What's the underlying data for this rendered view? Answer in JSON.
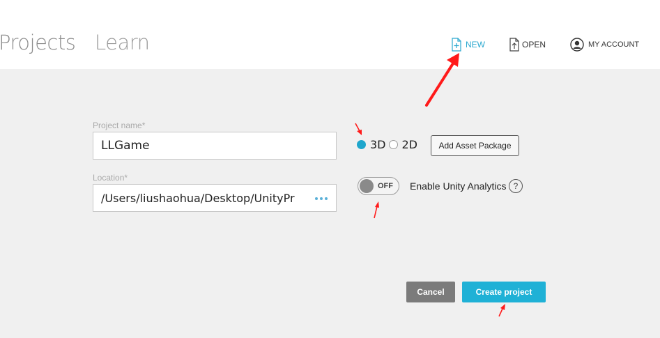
{
  "nav": {
    "tabs": [
      {
        "label": "Projects"
      },
      {
        "label": "Learn"
      }
    ]
  },
  "top_actions": {
    "new_label": "NEW",
    "open_label": "OPEN",
    "account_label": "MY ACCOUNT"
  },
  "form": {
    "project_name_label": "Project name*",
    "project_name_value": "LLGame",
    "location_label": "Location*",
    "location_value": "/Users/liushaohua/Desktop/UnityProg",
    "mode_options": [
      {
        "label": "3D",
        "selected": true
      },
      {
        "label": "2D",
        "selected": false
      }
    ],
    "add_asset_label": "Add Asset Package",
    "analytics_toggle_state": "OFF",
    "analytics_label": "Enable Unity Analytics",
    "help_glyph": "?"
  },
  "buttons": {
    "cancel_label": "Cancel",
    "create_label": "Create project"
  },
  "colors": {
    "accent": "#1fb1d6",
    "annotation_arrow": "#ff1a1a"
  },
  "icons": [
    "new-file-icon",
    "open-file-icon",
    "account-icon",
    "more-dots-icon",
    "help-icon"
  ]
}
